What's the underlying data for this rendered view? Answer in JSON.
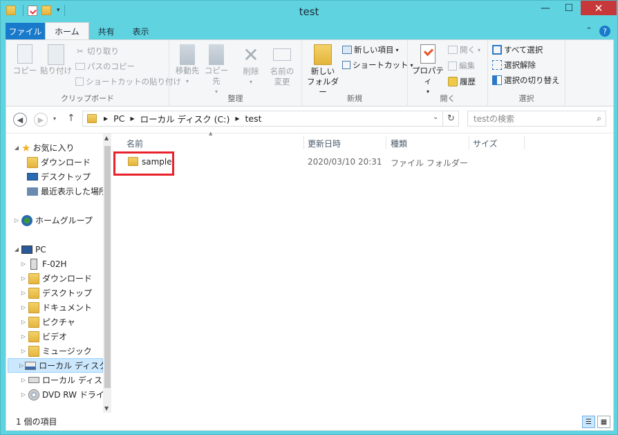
{
  "window": {
    "title": "test",
    "minimize": "—",
    "maximize": "☐",
    "close": "✕"
  },
  "ribbon_tabs": [
    "ファイル",
    "ホーム",
    "共有",
    "表示"
  ],
  "help": {
    "collapse": "⌃",
    "help": "?"
  },
  "clipboard": {
    "copy": "コピー",
    "paste": "貼り付け",
    "cut": "切り取り",
    "copy_path": "パスのコピー",
    "paste_shortcut": "ショートカットの貼り付け",
    "label": "クリップボード"
  },
  "organize": {
    "move_to": "移動先",
    "copy_to": "コピー先",
    "delete": "削除",
    "rename_line1": "名前の",
    "rename_line2": "変更",
    "label": "整理"
  },
  "new": {
    "new_folder_line1": "新しい",
    "new_folder_line2": "フォルダー",
    "new_item": "新しい項目",
    "shortcut": "ショートカット",
    "label": "新規"
  },
  "open": {
    "properties": "プロパティ",
    "open": "開く",
    "edit": "編集",
    "history": "履歴",
    "label": "開く"
  },
  "select": {
    "select_all": "すべて選択",
    "select_none": "選択解除",
    "invert": "選択の切り替え",
    "label": "選択"
  },
  "address": {
    "crumbs": [
      "PC",
      "ローカル ディスク (C:)",
      "test"
    ],
    "search_placeholder": "testの検索"
  },
  "nav": {
    "favorites": "お気に入り",
    "fav_items": [
      "ダウンロード",
      "デスクトップ",
      "最近表示した場所"
    ],
    "homegroup": "ホームグループ",
    "pc": "PC",
    "pc_items": [
      "F-02H",
      "ダウンロード",
      "デスクトップ",
      "ドキュメント",
      "ピクチャ",
      "ビデオ",
      "ミュージック",
      "ローカル ディスク (",
      "ローカル ディスク (",
      "DVD RW ドライブ"
    ]
  },
  "columns": {
    "name": "名前",
    "modified": "更新日時",
    "type": "種類",
    "size": "サイズ"
  },
  "files": [
    {
      "name": "sample",
      "modified": "2020/03/10 20:31",
      "type": "ファイル フォルダー",
      "size": ""
    }
  ],
  "status": {
    "count": "1 個の項目"
  }
}
